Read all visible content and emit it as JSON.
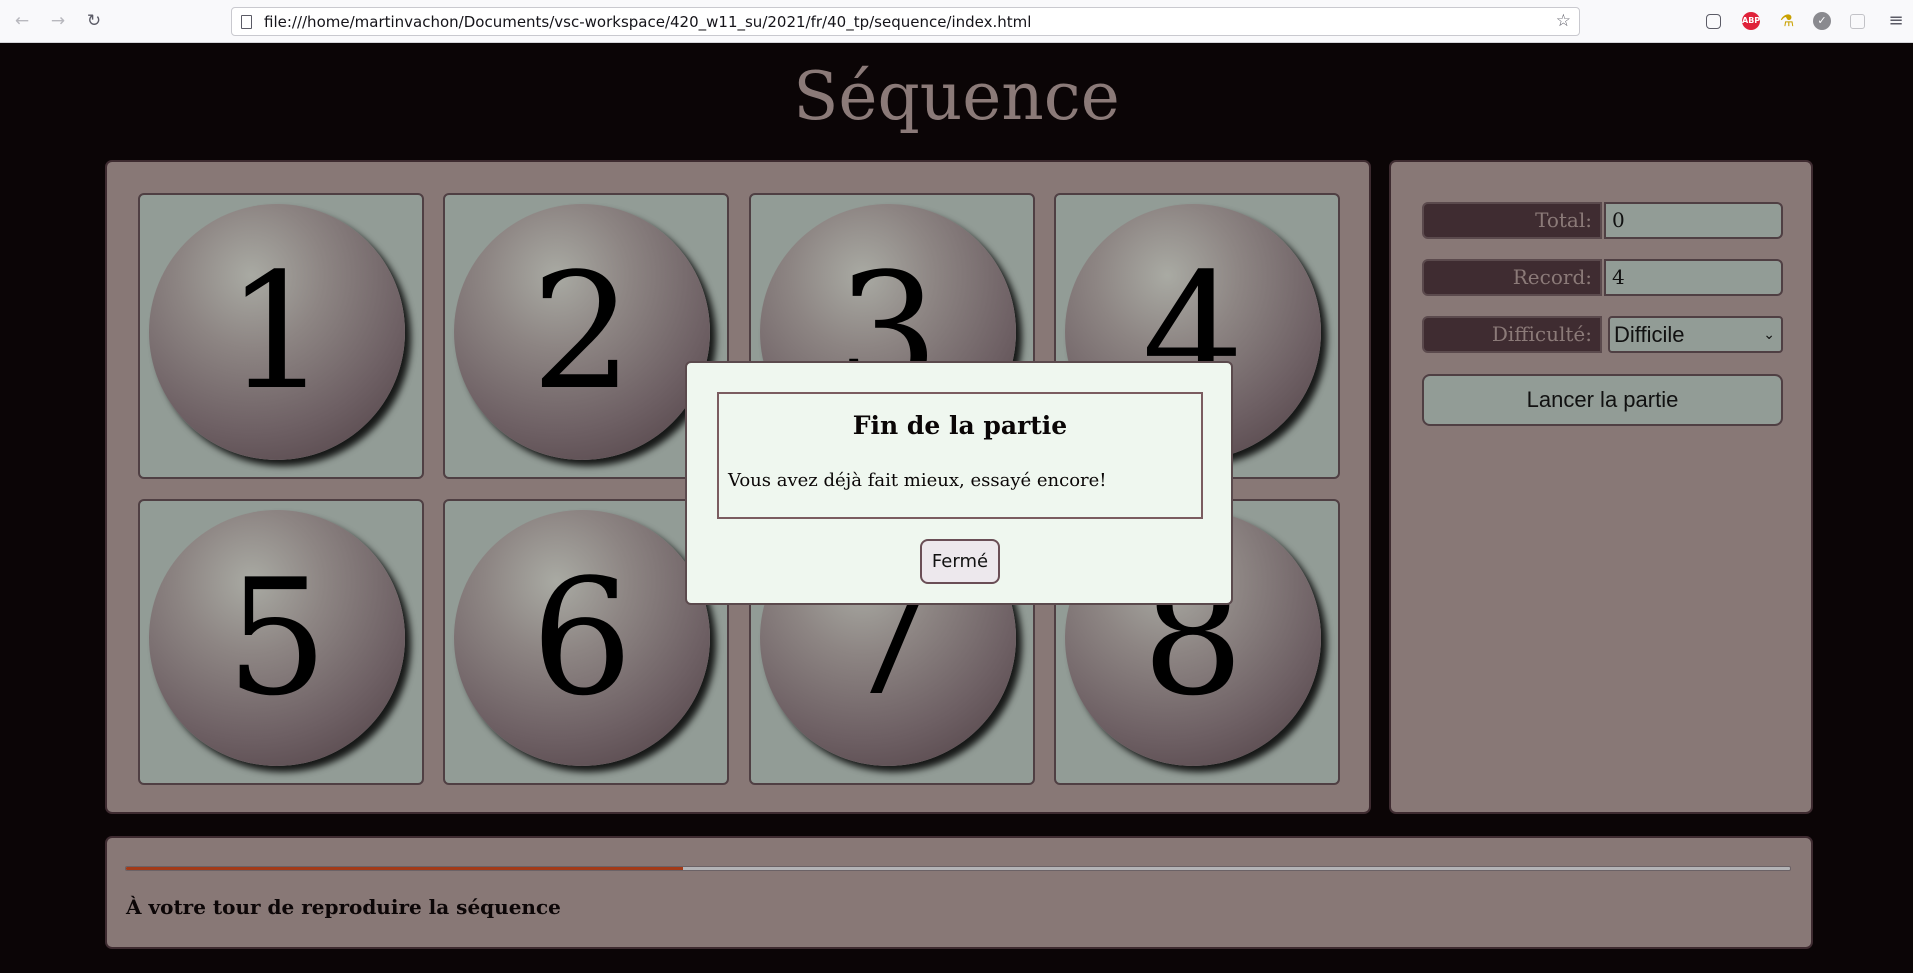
{
  "browser": {
    "url": "file:///home/martinvachon/Documents/vsc-workspace/420_w11_su/2021/fr/40_tp/sequence/index.html",
    "extensions": [
      {
        "icon": "pocket-icon"
      },
      {
        "icon": "adblock-icon",
        "label": "ABP"
      },
      {
        "icon": "flask-icon"
      },
      {
        "icon": "check-circle-icon"
      },
      {
        "icon": "extension-icon"
      }
    ]
  },
  "page": {
    "title": "Séquence"
  },
  "board": {
    "buttons": [
      "1",
      "2",
      "3",
      "4",
      "5",
      "6",
      "7",
      "8"
    ]
  },
  "side": {
    "total_label": "Total:",
    "total_value": "0",
    "record_label": "Record:",
    "record_value": "4",
    "difficulty_label": "Difficulté:",
    "difficulty_value": "Difficile",
    "launch_label": "Lancer la partie"
  },
  "status": {
    "progress_fraction": 0.335,
    "progress_color": "#a33a18",
    "message": "À votre tour de reproduire la séquence"
  },
  "modal": {
    "title": "Fin de la partie",
    "message": "Vous avez déjà fait mieux, essayé encore!",
    "close_label": "Fermé"
  },
  "colors": {
    "background": "#0b0506",
    "panel": "#887876",
    "cell": "#929c96",
    "modal": "#eff7ef"
  }
}
